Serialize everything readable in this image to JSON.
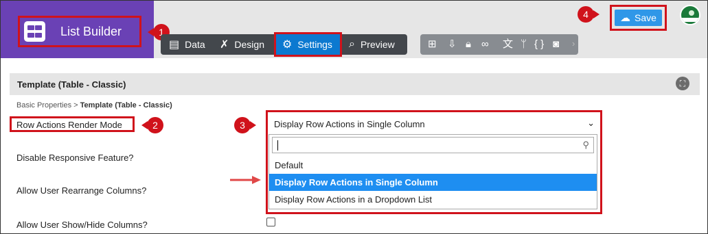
{
  "app": {
    "title": "List Builder",
    "logo_icon": "grid-icon"
  },
  "tabs": [
    {
      "label": "Data",
      "icon": "table-icon"
    },
    {
      "label": "Design",
      "icon": "design-tools-icon"
    },
    {
      "label": "Settings",
      "icon": "gear-icon",
      "active": true
    },
    {
      "label": "Preview",
      "icon": "preview-icon"
    }
  ],
  "toolbar_icons": [
    "sitemap-icon",
    "import-icon",
    "lock-icon",
    "binoculars-icon",
    "translate-icon",
    "branch-icon",
    "code-braces-icon",
    "camera-icon"
  ],
  "save": {
    "label": "Save",
    "icon": "cloud-upload-icon"
  },
  "callouts": {
    "one": "1",
    "two": "2",
    "three": "3",
    "four": "4"
  },
  "panel": {
    "title": "Template (Table - Classic)"
  },
  "breadcrumb": {
    "root": "Basic Properties",
    "sep": ">",
    "current": "Template (Table - Classic)"
  },
  "fields": {
    "row_actions_mode": "Row Actions Render Mode",
    "disable_responsive": "Disable Responsive Feature?",
    "rearrange_columns": "Allow User Rearrange Columns?",
    "show_hide_columns": "Allow User Show/Hide Columns?"
  },
  "select": {
    "value": "Display Row Actions in Single Column",
    "search_placeholder": "",
    "options": [
      "Default",
      "Display Row Actions in Single Column",
      "Display Row Actions in a Dropdown List"
    ],
    "selected_index": 1
  },
  "colors": {
    "brand": "#6a41b5",
    "accent": "#0b79d0",
    "highlight": "#1e8ef1",
    "callout": "#d0121b"
  }
}
